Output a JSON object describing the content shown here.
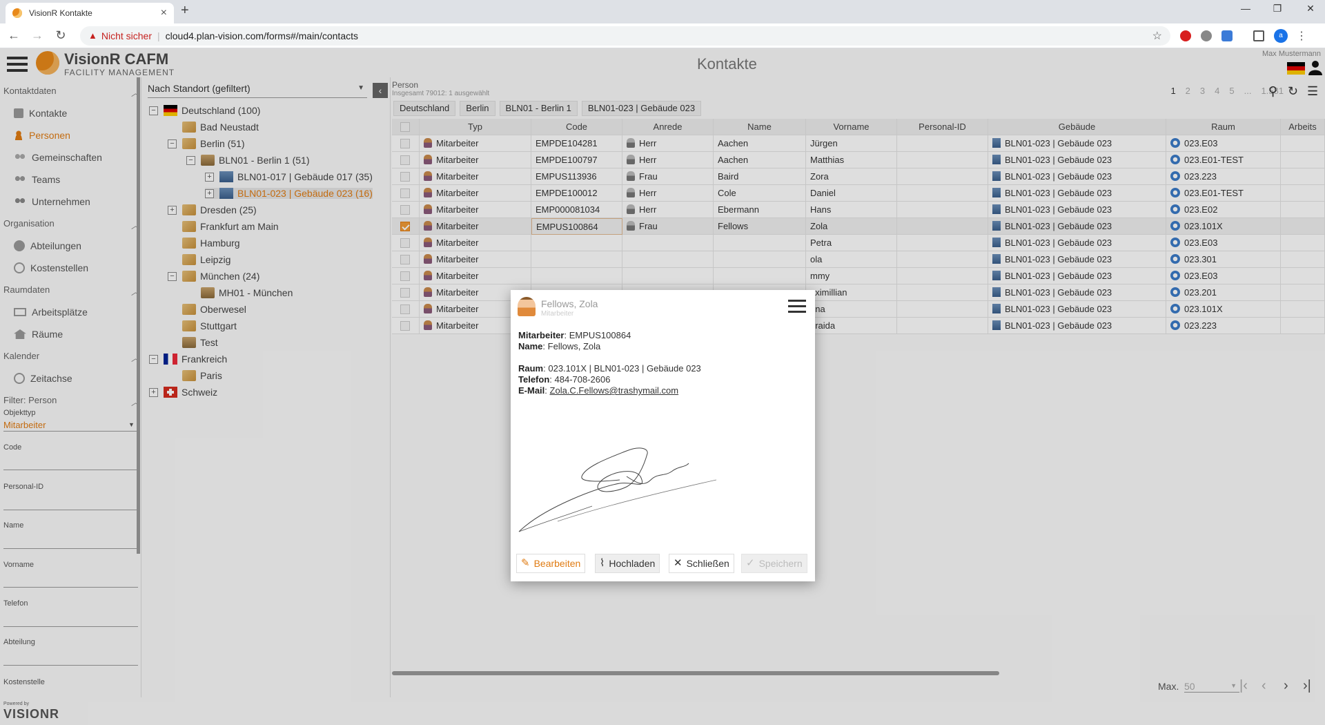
{
  "browser": {
    "tab_title": "VisionR Kontakte",
    "security_label": "Nicht sicher",
    "url": "cloud4.plan-vision.com/forms#/main/contacts",
    "profile_initial": "a"
  },
  "app": {
    "brand": "VisionR CAFM",
    "brand_sub": "FACILITY MANAGEMENT",
    "page_title": "Kontakte",
    "user_name": "Max Mustermann",
    "powered_by": "Powered by",
    "footer_logo": "VISIONR"
  },
  "sidebar": {
    "sections": [
      {
        "label": "Kontaktdaten",
        "items": [
          "Kontakte",
          "Personen",
          "Gemeinschaften",
          "Teams",
          "Unternehmen"
        ]
      },
      {
        "label": "Organisation",
        "items": [
          "Abteilungen",
          "Kostenstellen"
        ]
      },
      {
        "label": "Raumdaten",
        "items": [
          "Arbeitsplätze",
          "Räume"
        ]
      },
      {
        "label": "Kalender",
        "items": [
          "Zeitachse"
        ]
      }
    ],
    "filter_title": "Filter: Person",
    "objtype_label": "Objekttyp",
    "objtype_value": "Mitarbeiter",
    "fields": [
      "Code",
      "Personal-ID",
      "Name",
      "Vorname",
      "Telefon",
      "Abteilung",
      "Kostenstelle"
    ]
  },
  "tree": {
    "selector": "Nach Standort (gefiltert)",
    "nodes": [
      "Deutschland (100)",
      "Bad Neustadt",
      "Berlin (51)",
      "BLN01 - Berlin 1 (51)",
      "BLN01-017 | Gebäude 017 (35)",
      "BLN01-023 | Gebäude 023 (16)",
      "Dresden (25)",
      "Frankfurt am Main",
      "Hamburg",
      "Leipzig",
      "München (24)",
      "MH01 - München",
      "Oberwesel",
      "Stuttgart",
      "Test",
      "Frankreich",
      "Paris",
      "Schweiz"
    ]
  },
  "content": {
    "object_label": "Person",
    "summary": "Insgesamt 79012: 1 ausgewählt",
    "breadcrumbs": [
      "Deutschland",
      "Berlin",
      "BLN01 - Berlin 1",
      "BLN01-023 | Gebäude 023"
    ],
    "pages": [
      "1",
      "2",
      "3",
      "4",
      "5",
      "...",
      "1.581"
    ],
    "columns": [
      "Typ",
      "Code",
      "Anrede",
      "Name",
      "Vorname",
      "Personal-ID",
      "Gebäude",
      "Raum",
      "Arbeits"
    ],
    "rows": [
      [
        "Mitarbeiter",
        "EMPDE104281",
        "Herr",
        "Aachen",
        "Jürgen",
        "",
        "BLN01-023 | Gebäude 023",
        "023.E03"
      ],
      [
        "Mitarbeiter",
        "EMPDE100797",
        "Herr",
        "Aachen",
        "Matthias",
        "",
        "BLN01-023 | Gebäude 023",
        "023.E01-TEST"
      ],
      [
        "Mitarbeiter",
        "EMPUS113936",
        "Frau",
        "Baird",
        "Zora",
        "",
        "BLN01-023 | Gebäude 023",
        "023.223"
      ],
      [
        "Mitarbeiter",
        "EMPDE100012",
        "Herr",
        "Cole",
        "Daniel",
        "",
        "BLN01-023 | Gebäude 023",
        "023.E01-TEST"
      ],
      [
        "Mitarbeiter",
        "EMP000081034",
        "Herr",
        "Ebermann",
        "Hans",
        "",
        "BLN01-023 | Gebäude 023",
        "023.E02"
      ],
      [
        "Mitarbeiter",
        "EMPUS100864",
        "Frau",
        "Fellows",
        "Zola",
        "",
        "BLN01-023 | Gebäude 023",
        "023.101X"
      ],
      [
        "Mitarbeiter",
        "",
        "",
        "",
        "Petra",
        "",
        "BLN01-023 | Gebäude 023",
        "023.E03"
      ],
      [
        "Mitarbeiter",
        "",
        "",
        "",
        "ola",
        "",
        "BLN01-023 | Gebäude 023",
        "023.301"
      ],
      [
        "Mitarbeiter",
        "",
        "",
        "",
        "mmy",
        "",
        "BLN01-023 | Gebäude 023",
        "023.E03"
      ],
      [
        "Mitarbeiter",
        "",
        "",
        "",
        "aximillian",
        "",
        "BLN01-023 | Gebäude 023",
        "023.201"
      ],
      [
        "Mitarbeiter",
        "",
        "",
        "",
        "nna",
        "",
        "BLN01-023 | Gebäude 023",
        "023.101X"
      ],
      [
        "Mitarbeiter",
        "",
        "",
        "",
        "oraida",
        "",
        "BLN01-023 | Gebäude 023",
        "023.223"
      ]
    ],
    "max_label": "Max.",
    "max_value": "50"
  },
  "modal": {
    "name": "Fellows, Zola",
    "type": "Mitarbeiter",
    "k_emp": "Mitarbeiter",
    "v_emp": "EMPUS100864",
    "k_name": "Name",
    "v_name": "Fellows, Zola",
    "k_room": "Raum",
    "v_room": "023.101X | BLN01-023 | Gebäude 023",
    "k_tel": "Telefon",
    "v_tel": "484-708-2606",
    "k_mail": "E-Mail",
    "v_mail": "Zola.C.Fellows@trashymail.com",
    "buttons": {
      "edit": "Bearbeiten",
      "upload": "Hochladen",
      "close": "Schließen",
      "save": "Speichern"
    }
  }
}
